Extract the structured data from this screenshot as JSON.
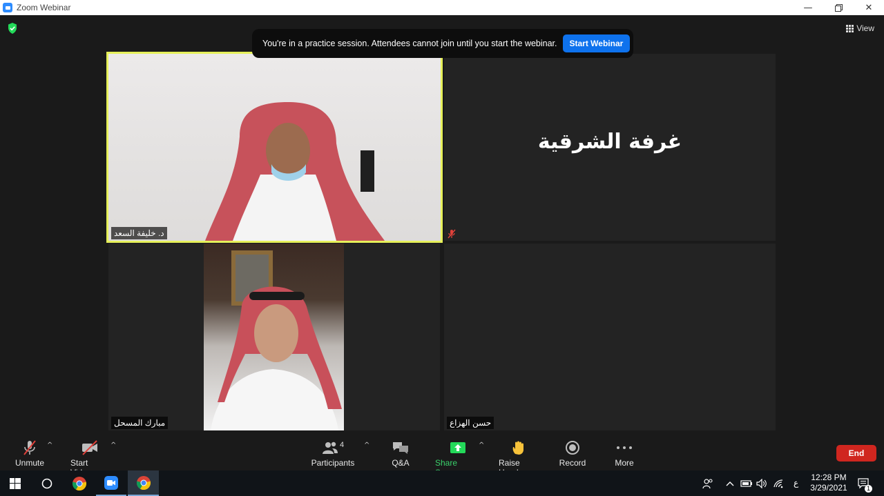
{
  "window": {
    "title": "Zoom Webinar"
  },
  "banner": {
    "message": "You're in a practice session. Attendees cannot join until you start the webinar.",
    "start_label": "Start Webinar"
  },
  "view_label": "View",
  "tiles": [
    {
      "name": "د. خليفة السعد",
      "active": true,
      "video": true
    },
    {
      "name": "",
      "room_label": "غرفة الشرقية",
      "muted": true,
      "video": false
    },
    {
      "name": "مبارك المسحل",
      "video": true
    },
    {
      "name": "حسن الهزاع",
      "video": false
    }
  ],
  "toolbar": {
    "unmute": "Unmute",
    "start_video": "Start Video",
    "participants": "Participants",
    "participants_count": "4",
    "qa": "Q&A",
    "share_screen": "Share Screen",
    "raise_hand": "Raise Hand",
    "record": "Record",
    "more": "More",
    "end": "End"
  },
  "taskbar": {
    "time": "12:28 PM",
    "date": "3/29/2021",
    "language": "ع",
    "notification_count": "1"
  },
  "colors": {
    "accent_blue": "#0e72ed",
    "end_red": "#d0261f",
    "share_green": "#3ad16b",
    "active_border": "#e6f05a"
  }
}
